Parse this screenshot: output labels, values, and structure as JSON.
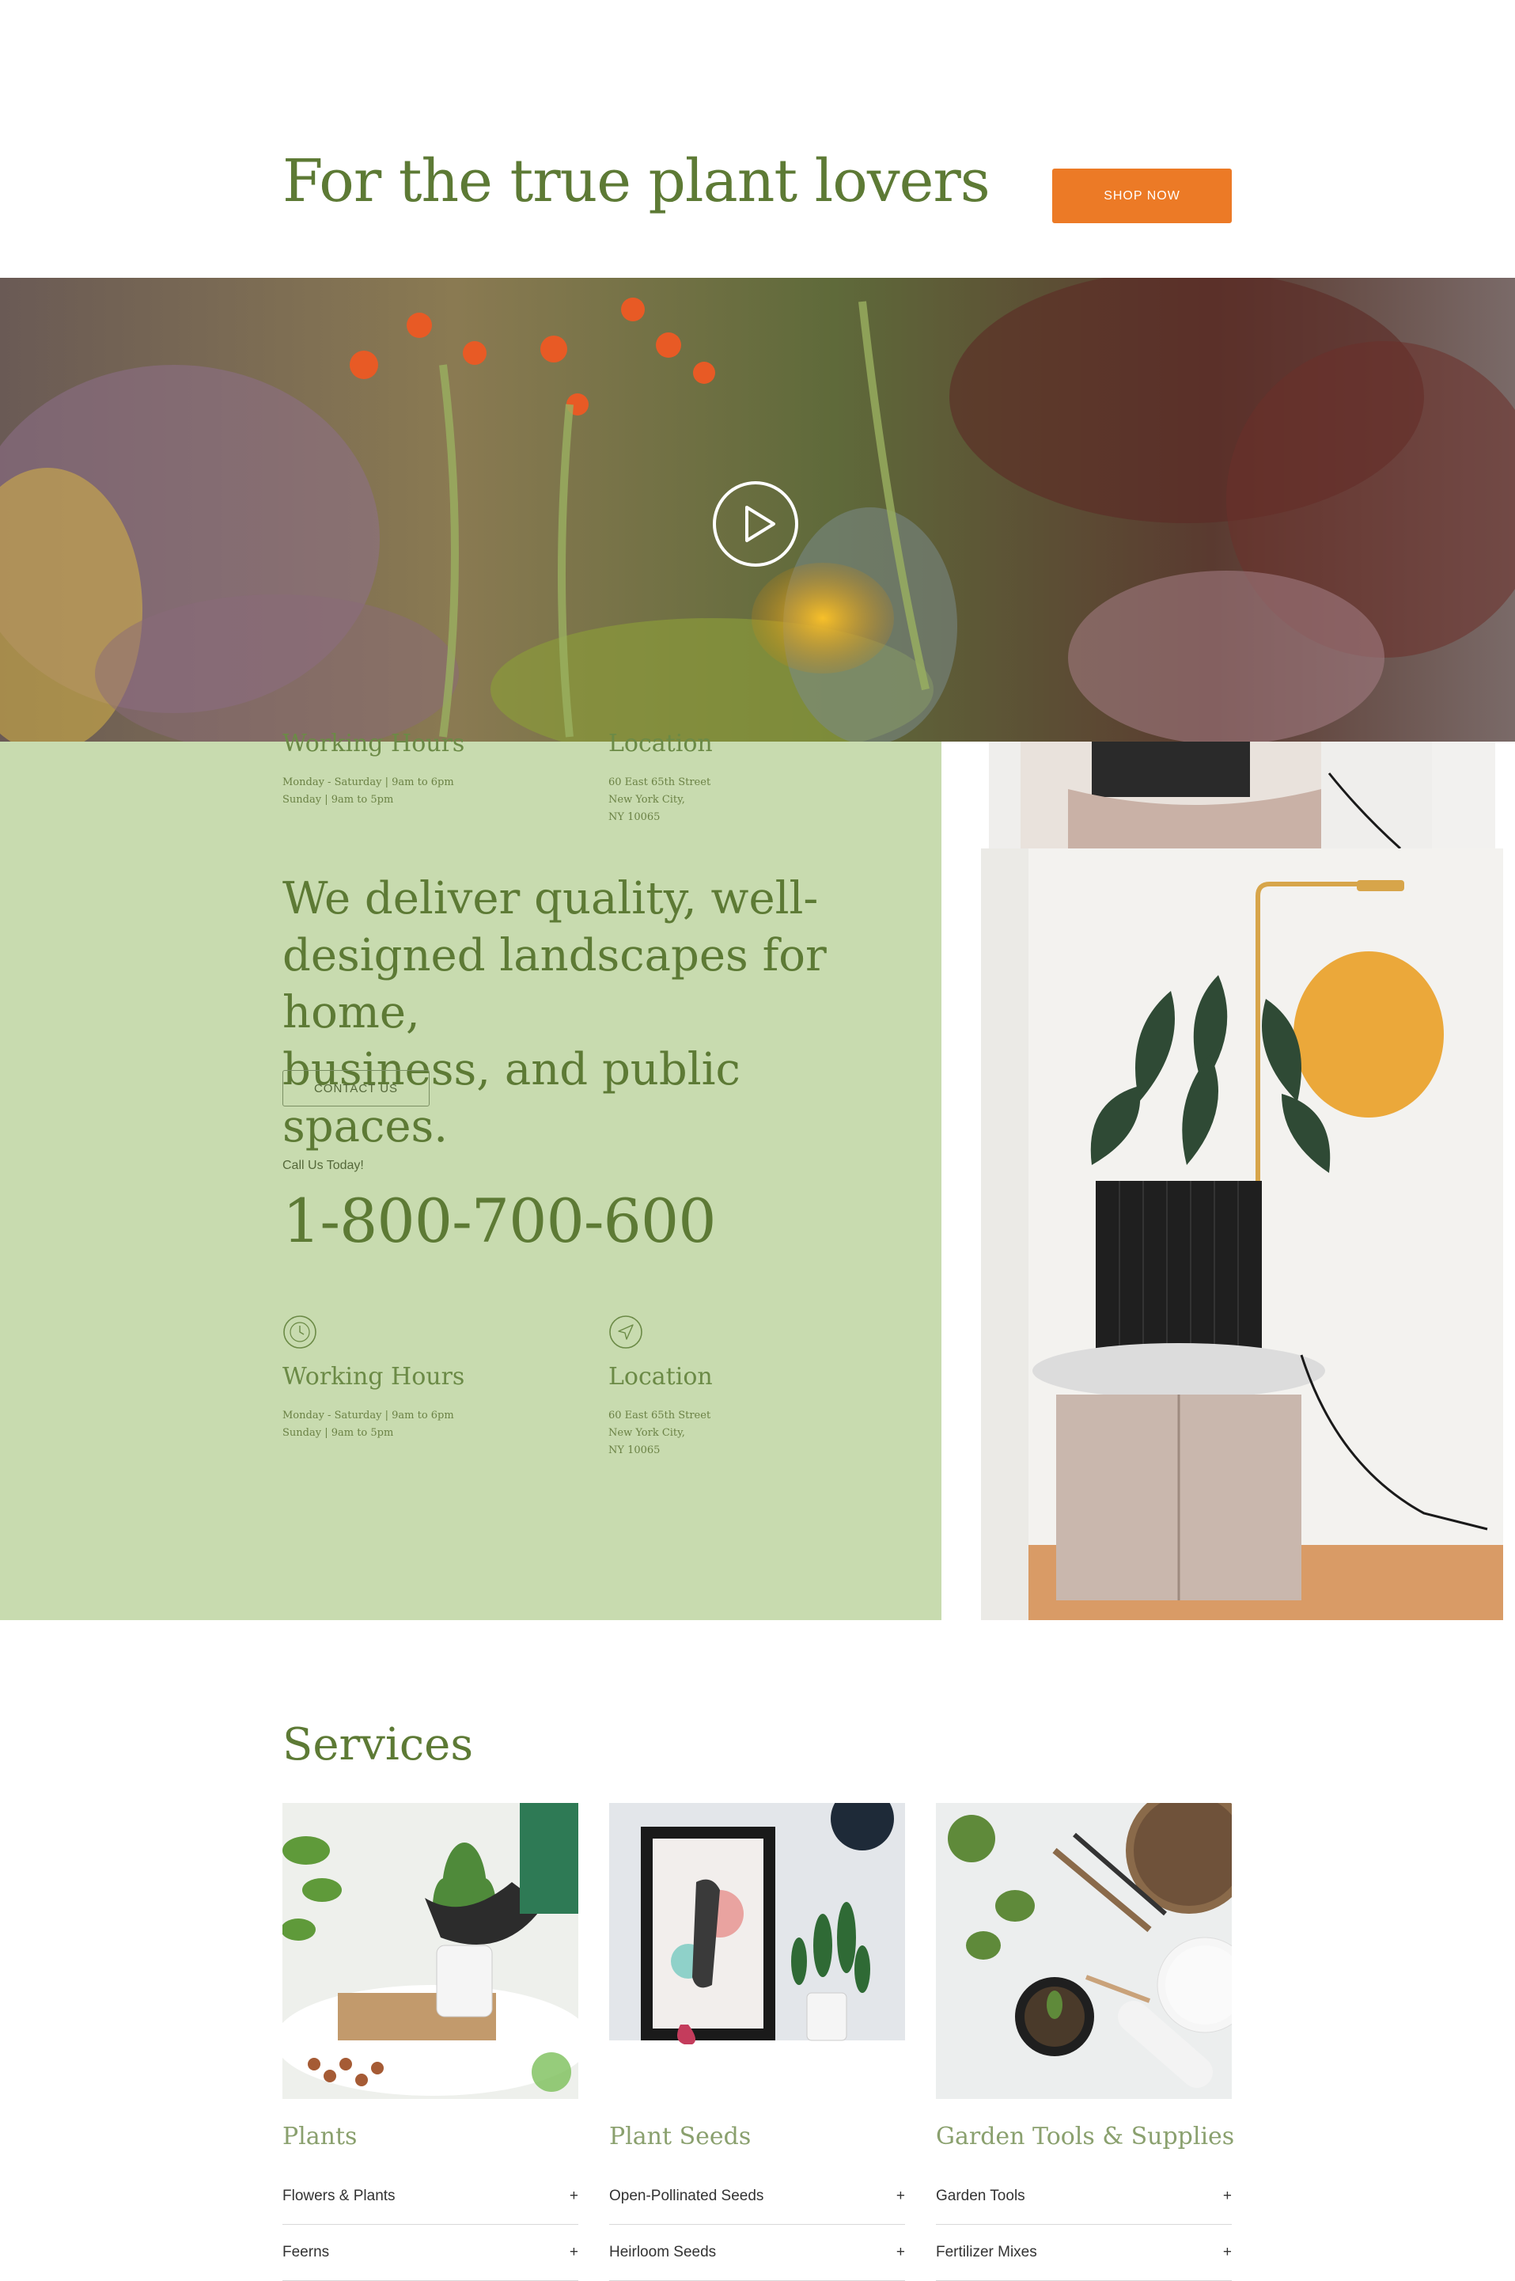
{
  "header": {
    "title": "For the true plant lovers",
    "shop_button": "SHOP NOW"
  },
  "info_top": {
    "hours_heading": "Working Hours",
    "hours_lines": [
      "Monday - Saturday | 9am to 6pm",
      "Sunday | 9am to 5pm"
    ],
    "location_heading": "Location",
    "location_lines": [
      "60 East 65th Street",
      "New York City,",
      "NY 10065"
    ]
  },
  "about": {
    "tagline_lines": [
      "We deliver quality, well-",
      "designed landscapes for home,",
      "business, and public spaces."
    ],
    "contact_button": "CONTACT US",
    "call_label": "Call Us Today!",
    "phone": "1-800-700-600"
  },
  "info_bottom": {
    "hours_heading": "Working Hours",
    "hours_lines": [
      "Monday - Saturday | 9am to 6pm",
      "Sunday | 9am to 5pm"
    ],
    "location_heading": "Location",
    "location_lines": [
      "60 East 65th Street",
      "New York City,",
      "NY 10065"
    ]
  },
  "services": {
    "title": "Services",
    "cards": [
      {
        "title": "Plants",
        "items": [
          "Flowers & Plants",
          "Feerns"
        ]
      },
      {
        "title": "Plant Seeds",
        "items": [
          "Open-Pollinated Seeds",
          "Heirloom Seeds"
        ]
      },
      {
        "title": "Garden Tools & Supplies",
        "items": [
          "Garden Tools",
          "Fertilizer Mixes"
        ]
      }
    ],
    "expand_symbol": "+"
  },
  "colors": {
    "accent_orange": "#ec7a26",
    "heading_green": "#5d7a35",
    "panel_green": "#c8dbaf"
  },
  "icons": [
    "play-icon",
    "clock-icon",
    "navigation-arrow-icon",
    "plus-icon"
  ]
}
